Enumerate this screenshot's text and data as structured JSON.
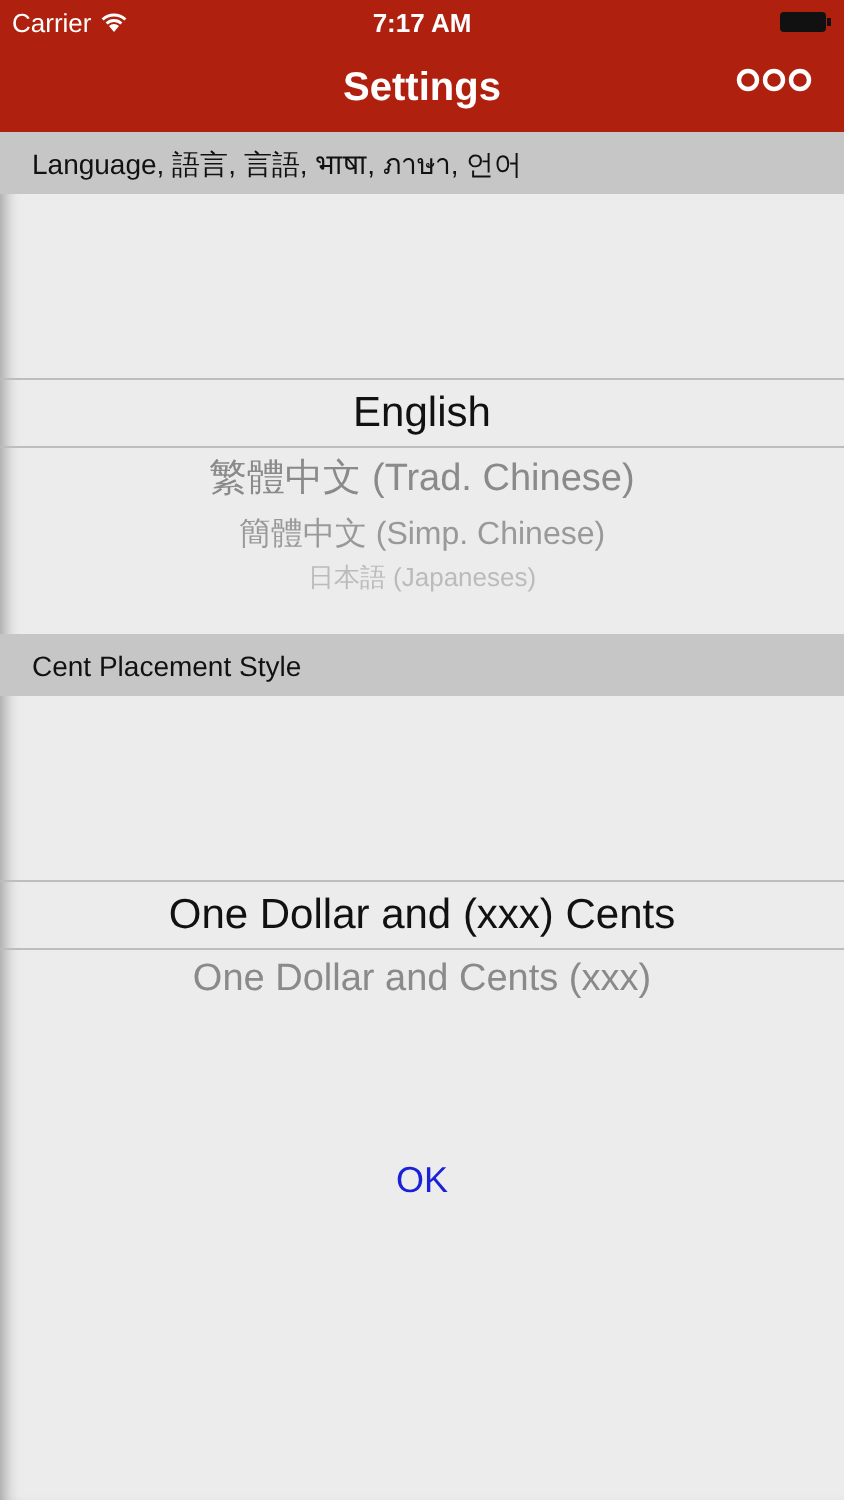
{
  "status_bar": {
    "carrier": "Carrier",
    "time": "7:17 AM"
  },
  "nav_bar": {
    "title": "Settings"
  },
  "sections": [
    {
      "header": "Language, 語言, 言語, भाषा, ภาษา, 언어",
      "options": [
        {
          "label": "English",
          "selected": true
        },
        {
          "label": "繁體中文 (Trad. Chinese)",
          "selected": false
        },
        {
          "label": "簡體中文 (Simp. Chinese)",
          "selected": false
        },
        {
          "label": "日本語 (Japaneses)",
          "selected": false
        }
      ]
    },
    {
      "header": "Cent Placement Style",
      "options": [
        {
          "label": "One Dollar and (xxx) Cents",
          "selected": true
        },
        {
          "label": "One Dollar and Cents (xxx)",
          "selected": false
        }
      ]
    }
  ],
  "ok_button": "OK"
}
